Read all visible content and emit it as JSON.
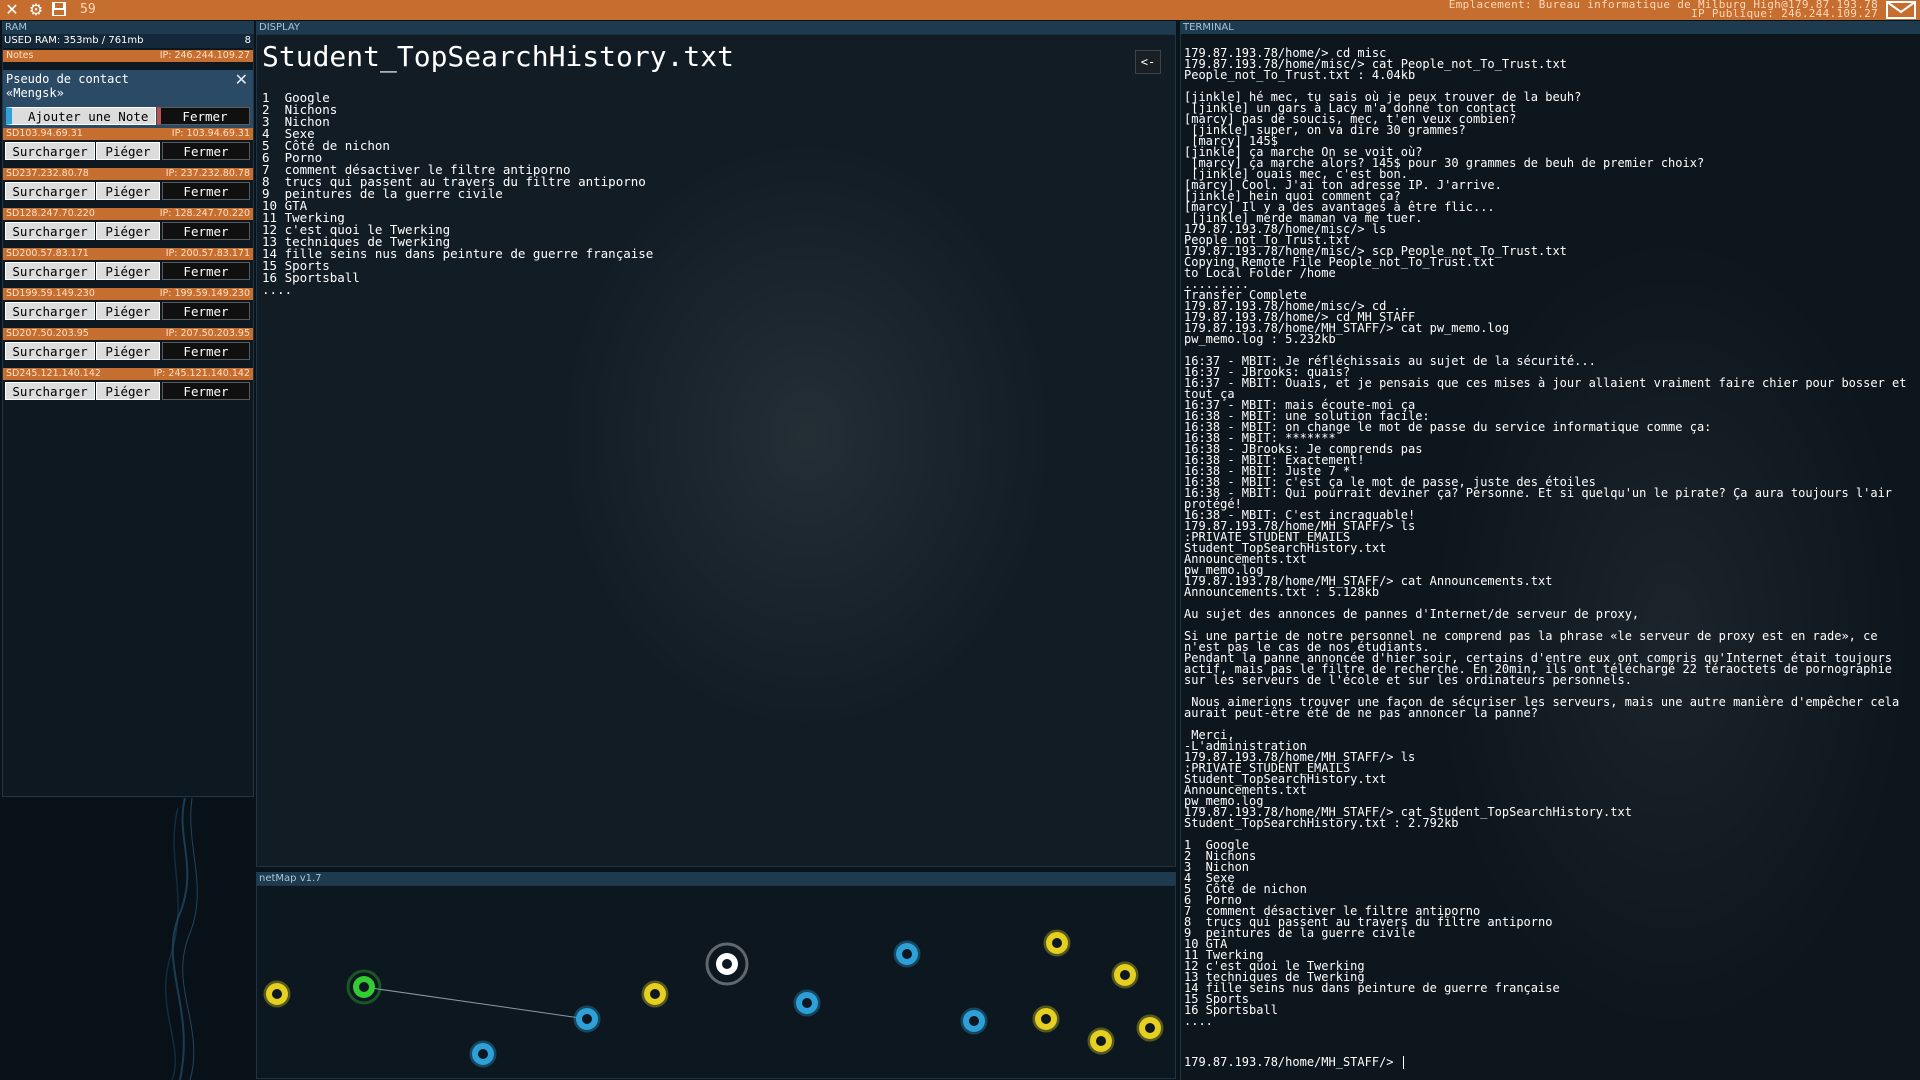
{
  "topbar": {
    "process_count": "59",
    "location": "Emplacement: Bureau informatique de Milburg High@179.87.193.78",
    "public_ip": "IP Publique: 246.244.109.27",
    "icons": [
      "close-icon",
      "gear-icon",
      "save-icon",
      "mail-icon"
    ],
    "color": "#c56e30"
  },
  "ram": {
    "header": "RAM",
    "used": "USED RAM: 353mb / 761mb",
    "count": "8",
    "notes_bar": {
      "label": "Notes",
      "ip": "IP: 246.244.109.27"
    },
    "notes": {
      "title": "Pseudo de contact\n«Mengsk»",
      "add_label": "Ajouter une Note",
      "close_label": "Fermer"
    },
    "processes": [
      {
        "label": "SD103.94.69.31",
        "ip": "IP: 103.94.69.31"
      },
      {
        "label": "SD237.232.80.78",
        "ip": "IP: 237.232.80.78"
      },
      {
        "label": "SD128.247.70.220",
        "ip": "IP: 128.247.70.220"
      },
      {
        "label": "SD200.57.83.171",
        "ip": "IP: 200.57.83.171"
      },
      {
        "label": "SD199.59.149.230",
        "ip": "IP: 199.59.149.230"
      },
      {
        "label": "SD207.50.203.95",
        "ip": "IP: 207.50.203.95"
      },
      {
        "label": "SD245.121.140.142",
        "ip": "IP: 245.121.140.142"
      }
    ],
    "btn_overload": "Surcharger",
    "btn_trap": "Piéger",
    "btn_close": "Fermer"
  },
  "display": {
    "header": "DISPLAY",
    "file_title": "Student_TopSearchHistory.txt",
    "back_label": "<-",
    "content": "1  Google\n2  Nichons\n3  Nichon\n4  Sexe\n5  Côté de nichon\n6  Porno\n7  comment désactiver le filtre antiporno\n8  trucs qui passent au travers du filtre antiporno\n9  peintures de la guerre civile\n10 GTA\n11 Twerking\n12 c'est quoi le Twerking\n13 techniques de Twerking\n14 fille seins nus dans peinture de guerre française\n15 Sports\n16 Sportsball\n...."
  },
  "netmap": {
    "header": "netMap v1.7",
    "nodes": [
      {
        "kind": "unowned",
        "color": "#e5d021"
      },
      {
        "kind": "owned",
        "color": "#33cc33"
      },
      {
        "kind": "linked",
        "color": "#2ea0d8"
      },
      {
        "kind": "unowned",
        "color": "#e5d021"
      },
      {
        "kind": "current",
        "color": "#ffffff"
      },
      {
        "kind": "target",
        "color": "#2ea0d8"
      },
      {
        "kind": "target",
        "color": "#2ea0d8"
      },
      {
        "kind": "target",
        "color": "#2ea0d8"
      },
      {
        "kind": "unowned",
        "color": "#e5d021"
      },
      {
        "kind": "unowned",
        "color": "#e5d021"
      },
      {
        "kind": "unowned",
        "color": "#e5d021"
      },
      {
        "kind": "unowned",
        "color": "#e5d021"
      },
      {
        "kind": "unowned",
        "color": "#e5d021"
      },
      {
        "kind": "home",
        "color": "#2ea0d8"
      }
    ]
  },
  "terminal": {
    "header": "TERMINAL",
    "lines": [
      "179.87.193.78/home/> cd misc",
      "179.87.193.78/home/misc/> cat People_not_To_Trust.txt",
      "People_not_To_Trust.txt : 4.04kb",
      "",
      "[jinkle] hé mec, tu sais où je peux trouver de la beuh?",
      " [jinkle] un gars à Lacy m'a donné ton contact",
      "[marcy] pas de soucis, mec, t'en veux combien?",
      " [jinkle] super, on va dire 30 grammes?",
      " [marcy] 145$",
      "[jinkle] ça marche On se voit où?",
      " [marcy] ça marche alors? 145$ pour 30 grammes de beuh de premier choix?",
      " [jinkle] ouais mec, c'est bon.",
      "[marcy] Cool. J'ai ton adresse IP. J'arrive.",
      "[jinkle] hein quoi comment ça?",
      "[marcy] Il y a des avantages à être flic...",
      " [jinkle] merde maman va me tuer.",
      "179.87.193.78/home/misc/> ls",
      "People_not_To_Trust.txt",
      "179.87.193.78/home/misc/> scp People_not_To_Trust.txt",
      "Copying Remote File People_not_To_Trust.txt",
      "to Local Folder /home",
      ".........",
      "Transfer Complete",
      "179.87.193.78/home/misc/> cd ..",
      "179.87.193.78/home/> cd MH_STAFF",
      "179.87.193.78/home/MH_STAFF/> cat pw_memo.log",
      "pw_memo.log : 5.232kb",
      "",
      "16:37 - MBIT: Je réfléchissais au sujet de la sécurité...",
      "16:37 - JBrooks: quais?",
      "16:37 - MBIT: Ouais, et je pensais que ces mises à jour allaient vraiment faire chier pour bosser et tout ça",
      "16:37 - MBIT: mais écoute-moi ça",
      "16:38 - MBIT: une solution facile:",
      "16:38 - MBIT: on change le mot de passe du service informatique comme ça:",
      "16:38 - MBIT: *******",
      "16:38 - JBrooks: Je comprends pas",
      "16:38 - MBIT: Exactement!",
      "16:38 - MBIT: Juste 7 *",
      "16:38 - MBIT: c'est ça le mot de passe, juste des étoiles",
      "16:38 - MBIT: Qui pourrait deviner ça? Personne. Et si quelqu'un le pirate? Ça aura toujours l'air protégé!",
      "16:38 - MBIT: C'est incraquable!",
      "179.87.193.78/home/MH_STAFF/> ls",
      ":PRIVATE_STUDENT_EMAILS",
      "Student_TopSearchHistory.txt",
      "Announcements.txt",
      "pw_memo.log",
      "179.87.193.78/home/MH_STAFF/> cat Announcements.txt",
      "Announcements.txt : 5.128kb",
      "",
      "Au sujet des annonces de pannes d'Internet/de serveur de proxy,",
      "",
      "Si une partie de notre personnel ne comprend pas la phrase «le serveur de proxy est en rade», ce n'est pas le cas de nos étudiants.",
      "Pendant la panne annoncée d'hier soir, certains d'entre eux ont compris qu'Internet était toujours actif, mais pas le filtre de recherche. En 20min, ils ont téléchargé 22 téraoctets de pornographie sur les serveurs de l'école et sur les ordinateurs personnels.",
      "",
      " Nous aimerions trouver une façon de sécuriser les serveurs, mais une autre manière d'empêcher cela aurait peut-être été de ne pas annoncer la panne?",
      "",
      " Merci,",
      "-L'administration",
      "179.87.193.78/home/MH_STAFF/> ls",
      ":PRIVATE_STUDENT_EMAILS",
      "Student_TopSearchHistory.txt",
      "Announcements.txt",
      "pw_memo.log",
      "179.87.193.78/home/MH_STAFF/> cat Student_TopSearchHistory.txt",
      "Student_TopSearchHistory.txt : 2.792kb",
      "",
      "1  Google",
      "2  Nichons",
      "3  Nichon",
      "4  Sexe",
      "5  Côté de nichon",
      "6  Porno",
      "7  comment désactiver le filtre antiporno",
      "8  trucs qui passent au travers du filtre antiporno",
      "9  peintures de la guerre civile",
      "10 GTA",
      "11 Twerking",
      "12 c'est quoi le Twerking",
      "13 techniques de Twerking",
      "14 fille seins nus dans peinture de guerre française",
      "15 Sports",
      "16 Sportsball",
      "...."
    ],
    "prompt": "179.87.193.78/home/MH_STAFF/> "
  }
}
